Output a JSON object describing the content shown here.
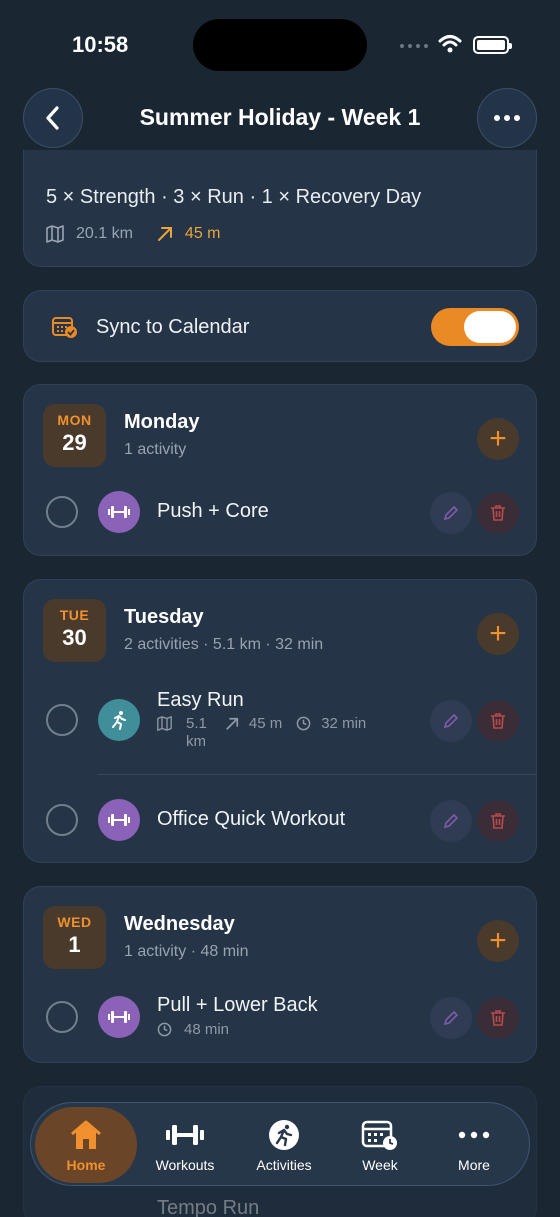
{
  "status": {
    "time": "10:58"
  },
  "header": {
    "title": "Summer Holiday - Week 1"
  },
  "summary": {
    "line": "5 × Strength · 3 × Run · 1 × Recovery Day",
    "distance": "20.1 km",
    "elevation": "45 m"
  },
  "sync": {
    "label": "Sync to Calendar",
    "enabled": true
  },
  "days": [
    {
      "abbr": "MON",
      "num": "29",
      "name": "Monday",
      "sub": "1 activity",
      "activities": [
        {
          "title": "Push + Core",
          "type": "strength"
        }
      ]
    },
    {
      "abbr": "TUE",
      "num": "30",
      "name": "Tuesday",
      "sub": "2 activities · 5.1 km · 32 min",
      "activities": [
        {
          "title": "Easy Run",
          "type": "run",
          "distance_a": "5.1",
          "distance_b": "km",
          "elevation": "45 m",
          "duration": "32 min"
        },
        {
          "title": "Office Quick Workout",
          "type": "strength"
        }
      ]
    },
    {
      "abbr": "WED",
      "num": "1",
      "name": "Wednesday",
      "sub": "1 activity · 48 min",
      "activities": [
        {
          "title": "Pull + Lower Back",
          "type": "strength",
          "duration": "48 min"
        }
      ]
    }
  ],
  "peek": {
    "title": "Tempo Run"
  },
  "tabs": [
    {
      "label": "Home",
      "icon": "house-icon",
      "active": true
    },
    {
      "label": "Workouts",
      "icon": "dumbbell-icon"
    },
    {
      "label": "Activities",
      "icon": "runner-icon"
    },
    {
      "label": "Week",
      "icon": "calendar-clock-icon"
    },
    {
      "label": "More",
      "icon": "ellipsis-icon"
    }
  ],
  "colors": {
    "accent": "#ea8a25",
    "strength": "#8a63b8",
    "run": "#3f8e9a",
    "background": "#1b2633"
  }
}
